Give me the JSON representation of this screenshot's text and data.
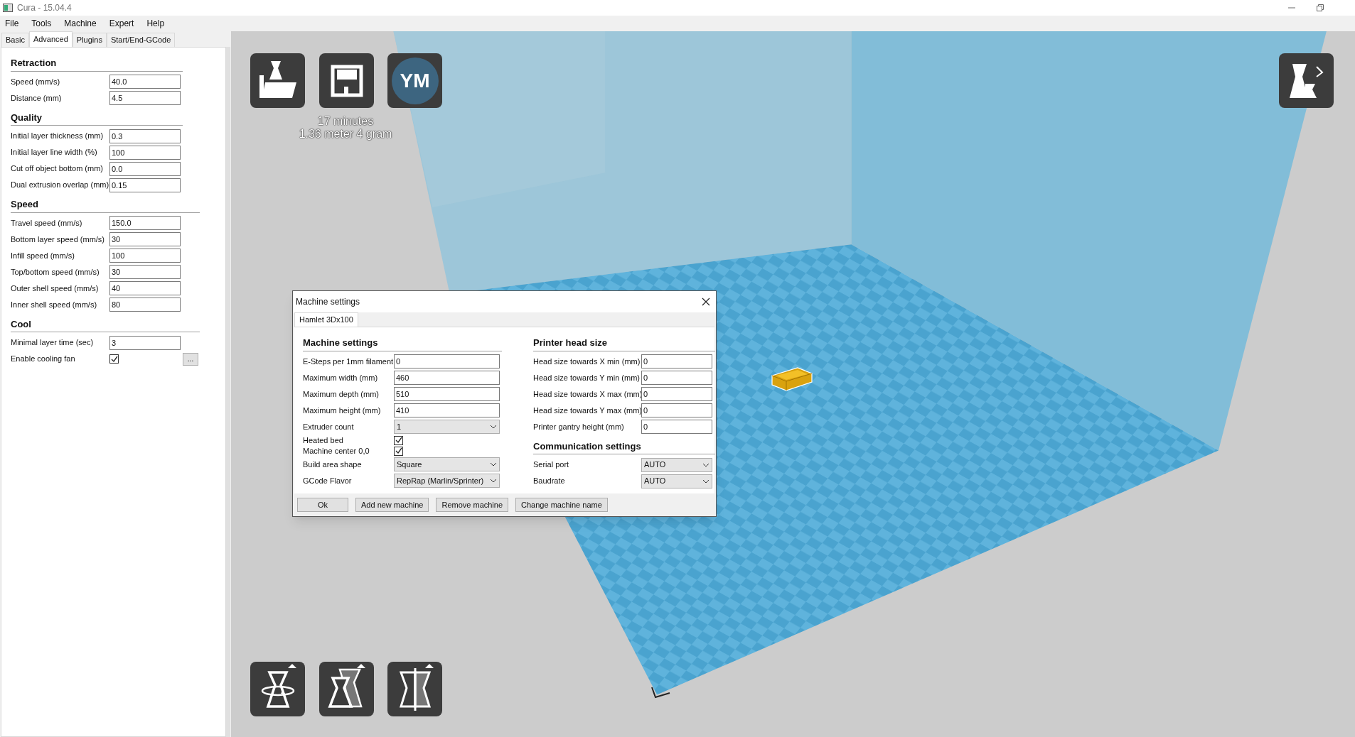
{
  "window": {
    "title": "Cura - 15.04.4"
  },
  "menu": [
    "File",
    "Tools",
    "Machine",
    "Expert",
    "Help"
  ],
  "tabs": [
    {
      "label": "Basic",
      "selected": false
    },
    {
      "label": "Advanced",
      "selected": true
    },
    {
      "label": "Plugins",
      "selected": false
    },
    {
      "label": "Start/End-GCode",
      "selected": false
    }
  ],
  "sections": [
    {
      "title": "Retraction",
      "rows": [
        {
          "kind": "field",
          "label": "Speed (mm/s)",
          "value": "40.0"
        },
        {
          "kind": "field",
          "label": "Distance (mm)",
          "value": "4.5"
        }
      ]
    },
    {
      "title": "Quality",
      "rows": [
        {
          "kind": "field",
          "label": "Initial layer thickness (mm)",
          "value": "0.3"
        },
        {
          "kind": "field",
          "label": "Initial layer line width (%)",
          "value": "100"
        },
        {
          "kind": "field",
          "label": "Cut off object bottom (mm)",
          "value": "0.0"
        },
        {
          "kind": "field",
          "label": "Dual extrusion overlap (mm)",
          "value": "0.15"
        }
      ]
    },
    {
      "title": "Speed",
      "rows": [
        {
          "kind": "field",
          "label": "Travel speed (mm/s)",
          "value": "150.0"
        },
        {
          "kind": "field",
          "label": "Bottom layer speed (mm/s)",
          "value": "30"
        },
        {
          "kind": "field",
          "label": "Infill speed (mm/s)",
          "value": "100"
        },
        {
          "kind": "field",
          "label": "Top/bottom speed (mm/s)",
          "value": "30"
        },
        {
          "kind": "field",
          "label": "Outer shell speed (mm/s)",
          "value": "40"
        },
        {
          "kind": "field",
          "label": "Inner shell speed (mm/s)",
          "value": "80"
        }
      ]
    },
    {
      "title": "Cool",
      "rows": [
        {
          "kind": "field",
          "label": "Minimal layer time (sec)",
          "value": "3"
        },
        {
          "kind": "checkbox",
          "label": "Enable cooling fan",
          "checked": true,
          "button": "..."
        }
      ]
    }
  ],
  "viewport": {
    "badge": "YM",
    "print_info": [
      "17 minutes",
      "1.36 meter 4 gram"
    ]
  },
  "dialog": {
    "title": "Machine settings",
    "tabs": [
      {
        "label": "Hamlet 3Dx100",
        "selected": true
      }
    ],
    "left": [
      {
        "title": "Machine settings",
        "rows": [
          {
            "kind": "field",
            "label": "E-Steps per 1mm filament",
            "value": "0"
          },
          {
            "kind": "field",
            "label": "Maximum width (mm)",
            "value": "460"
          },
          {
            "kind": "field",
            "label": "Maximum depth (mm)",
            "value": "510"
          },
          {
            "kind": "field",
            "label": "Maximum height (mm)",
            "value": "410"
          },
          {
            "kind": "select",
            "label": "Extruder count",
            "value": "1"
          },
          {
            "kind": "checkbox",
            "label": "Heated bed",
            "checked": true
          },
          {
            "kind": "checkbox",
            "label": "Machine center 0,0",
            "checked": true
          },
          {
            "kind": "select",
            "label": "Build area shape",
            "value": "Square"
          },
          {
            "kind": "select",
            "label": "GCode Flavor",
            "value": "RepRap (Marlin/Sprinter)"
          }
        ]
      }
    ],
    "right": [
      {
        "title": "Printer head size",
        "rows": [
          {
            "kind": "field",
            "label": "Head size towards X min (mm)",
            "value": "0"
          },
          {
            "kind": "field",
            "label": "Head size towards Y min (mm)",
            "value": "0"
          },
          {
            "kind": "field",
            "label": "Head size towards X max (mm)",
            "value": "0"
          },
          {
            "kind": "field",
            "label": "Head size towards Y max (mm)",
            "value": "0"
          },
          {
            "kind": "field",
            "label": "Printer gantry height (mm)",
            "value": "0"
          }
        ]
      },
      {
        "title": "Communication settings",
        "rows": [
          {
            "kind": "select",
            "label": "Serial port",
            "value": "AUTO"
          },
          {
            "kind": "select",
            "label": "Baudrate",
            "value": "AUTO"
          }
        ]
      }
    ],
    "buttons": [
      "Ok",
      "Add new machine",
      "Remove machine",
      "Change machine name"
    ]
  }
}
